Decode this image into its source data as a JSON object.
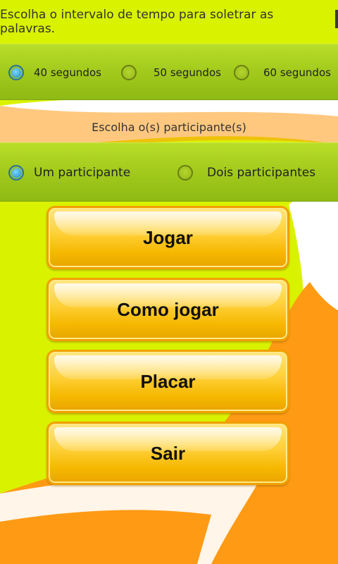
{
  "header": {
    "time_title": "Escolha o intervalo de tempo para soletrar as palavras."
  },
  "time_options": [
    {
      "label": "40 segundos",
      "checked": true
    },
    {
      "label": "50 segundos",
      "checked": false
    },
    {
      "label": "60 segundos",
      "checked": false
    }
  ],
  "participants": {
    "title": "Escolha o(s) participante(s)",
    "options": [
      {
        "label": "Um participante",
        "checked": true
      },
      {
        "label": "Dois participantes",
        "checked": false
      }
    ]
  },
  "menu": {
    "play": "Jogar",
    "how_to_play": "Como jogar",
    "scoreboard": "Placar",
    "exit": "Sair"
  },
  "colors": {
    "background": "#d9f200",
    "option_bar": "#a4cc1d",
    "button": "#ffd23d",
    "accent_orange": "#ff9a14",
    "radio_selected": "#1a8cc8"
  }
}
